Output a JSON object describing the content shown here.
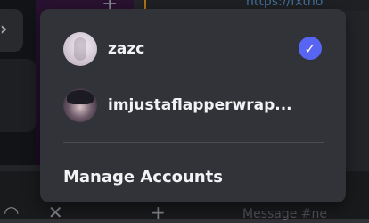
{
  "background": {
    "link_text": "https://fxtho",
    "message_placeholder": "Message #ne"
  },
  "accounts": [
    {
      "name": "zazc",
      "selected": true
    },
    {
      "name": "imjustaflapperwrap..."
    }
  ],
  "manage_label": "Manage Accounts",
  "colors": {
    "popup_bg": "#313338",
    "check_accent": "#5865f2"
  }
}
